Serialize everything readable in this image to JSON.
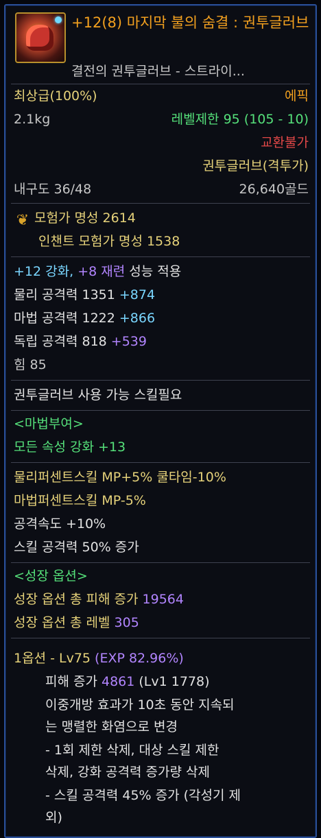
{
  "item": {
    "title": "+12(8) 마지막 불의 숨결 : 권투글러브",
    "subtitle": "결전의 권투글러브 - 스트라이...",
    "grade": "최상급(100%)",
    "rarity": "에픽",
    "weight": "2.1kg",
    "level_limit": "레벨제한 95 (105 - 10)",
    "trade": "교환불가",
    "type": "권투글러브(격투가)",
    "durability": "내구도 36/48",
    "price": "26,640골드"
  },
  "fame": {
    "icon": "laurel-icon",
    "adventurer_fame": "모험가 명성 2614",
    "enchant_fame": "인챈트 모험가 명성 1538"
  },
  "stats": {
    "enhance_prefix": "+12 강화, ",
    "refine": "+8 재련",
    "enhance_suffix": " 성능 적용",
    "physical_label": "물리 공격력 1351 ",
    "physical_bonus": "+874",
    "magic_label": "마법 공격력 1222 ",
    "magic_bonus": "+866",
    "indep_label": "독립 공격력 818 ",
    "indep_bonus": "+539",
    "strength": "힘 85"
  },
  "skill_req": "권투글러브 사용 가능 스킬필요",
  "enchant": {
    "header": "<마법부여>",
    "line": "모든 속성 강화 +13"
  },
  "options": {
    "line1": "물리퍼센트스킬 MP+5% 쿨타임-10%",
    "line2": "마법퍼센트스킬 MP-5%",
    "line3": "공격속도 +10%",
    "line4": "스킬 공격력 50% 증가"
  },
  "growth": {
    "header": "<성장 옵션>",
    "damage_label": "성장 옵션 총 피해 증가 ",
    "damage_value": "19564",
    "level_label": "성장 옵션 총 레벨 ",
    "level_value": "305",
    "opt1_prefix": "1옵션 - Lv75 ",
    "opt1_exp": "(EXP 82.96%)",
    "dmg_label": "피해 증가 ",
    "dmg_value": "4861",
    "dmg_lv": " (Lv1 1778)",
    "desc1": "이중개방 효과가 10초 동안 지속되",
    "desc2": "는 맹렬한 화염으로 변경",
    "desc3": "- 1회 제한 삭제, 대상 스킬 제한",
    "desc4": "삭제, 강화 공격력 증가량 삭제",
    "desc5": "- 스킬 공격력 45% 증가 (각성기 제",
    "desc6": "외)"
  }
}
